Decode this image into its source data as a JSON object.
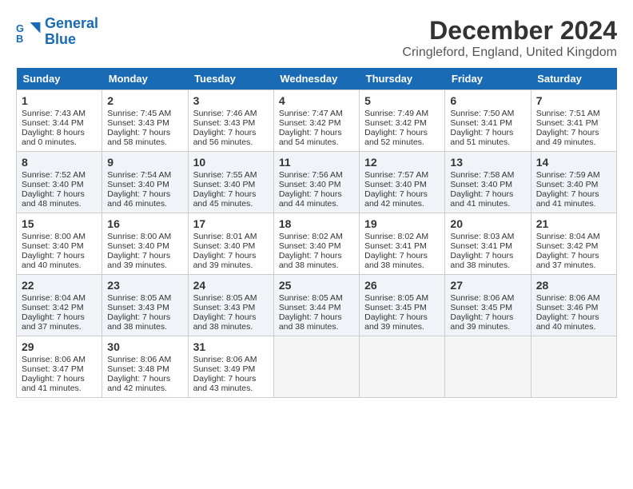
{
  "header": {
    "logo_line1": "General",
    "logo_line2": "Blue",
    "title": "December 2024",
    "subtitle": "Cringleford, England, United Kingdom"
  },
  "days_of_week": [
    "Sunday",
    "Monday",
    "Tuesday",
    "Wednesday",
    "Thursday",
    "Friday",
    "Saturday"
  ],
  "weeks": [
    [
      {
        "day": 1,
        "sunrise": "7:43 AM",
        "sunset": "3:44 PM",
        "daylight": "8 hours and 0 minutes."
      },
      {
        "day": 2,
        "sunrise": "7:45 AM",
        "sunset": "3:43 PM",
        "daylight": "7 hours and 58 minutes."
      },
      {
        "day": 3,
        "sunrise": "7:46 AM",
        "sunset": "3:43 PM",
        "daylight": "7 hours and 56 minutes."
      },
      {
        "day": 4,
        "sunrise": "7:47 AM",
        "sunset": "3:42 PM",
        "daylight": "7 hours and 54 minutes."
      },
      {
        "day": 5,
        "sunrise": "7:49 AM",
        "sunset": "3:42 PM",
        "daylight": "7 hours and 52 minutes."
      },
      {
        "day": 6,
        "sunrise": "7:50 AM",
        "sunset": "3:41 PM",
        "daylight": "7 hours and 51 minutes."
      },
      {
        "day": 7,
        "sunrise": "7:51 AM",
        "sunset": "3:41 PM",
        "daylight": "7 hours and 49 minutes."
      }
    ],
    [
      {
        "day": 8,
        "sunrise": "7:52 AM",
        "sunset": "3:40 PM",
        "daylight": "7 hours and 48 minutes."
      },
      {
        "day": 9,
        "sunrise": "7:54 AM",
        "sunset": "3:40 PM",
        "daylight": "7 hours and 46 minutes."
      },
      {
        "day": 10,
        "sunrise": "7:55 AM",
        "sunset": "3:40 PM",
        "daylight": "7 hours and 45 minutes."
      },
      {
        "day": 11,
        "sunrise": "7:56 AM",
        "sunset": "3:40 PM",
        "daylight": "7 hours and 44 minutes."
      },
      {
        "day": 12,
        "sunrise": "7:57 AM",
        "sunset": "3:40 PM",
        "daylight": "7 hours and 42 minutes."
      },
      {
        "day": 13,
        "sunrise": "7:58 AM",
        "sunset": "3:40 PM",
        "daylight": "7 hours and 41 minutes."
      },
      {
        "day": 14,
        "sunrise": "7:59 AM",
        "sunset": "3:40 PM",
        "daylight": "7 hours and 41 minutes."
      }
    ],
    [
      {
        "day": 15,
        "sunrise": "8:00 AM",
        "sunset": "3:40 PM",
        "daylight": "7 hours and 40 minutes."
      },
      {
        "day": 16,
        "sunrise": "8:00 AM",
        "sunset": "3:40 PM",
        "daylight": "7 hours and 39 minutes."
      },
      {
        "day": 17,
        "sunrise": "8:01 AM",
        "sunset": "3:40 PM",
        "daylight": "7 hours and 39 minutes."
      },
      {
        "day": 18,
        "sunrise": "8:02 AM",
        "sunset": "3:40 PM",
        "daylight": "7 hours and 38 minutes."
      },
      {
        "day": 19,
        "sunrise": "8:02 AM",
        "sunset": "3:41 PM",
        "daylight": "7 hours and 38 minutes."
      },
      {
        "day": 20,
        "sunrise": "8:03 AM",
        "sunset": "3:41 PM",
        "daylight": "7 hours and 38 minutes."
      },
      {
        "day": 21,
        "sunrise": "8:04 AM",
        "sunset": "3:42 PM",
        "daylight": "7 hours and 37 minutes."
      }
    ],
    [
      {
        "day": 22,
        "sunrise": "8:04 AM",
        "sunset": "3:42 PM",
        "daylight": "7 hours and 37 minutes."
      },
      {
        "day": 23,
        "sunrise": "8:05 AM",
        "sunset": "3:43 PM",
        "daylight": "7 hours and 38 minutes."
      },
      {
        "day": 24,
        "sunrise": "8:05 AM",
        "sunset": "3:43 PM",
        "daylight": "7 hours and 38 minutes."
      },
      {
        "day": 25,
        "sunrise": "8:05 AM",
        "sunset": "3:44 PM",
        "daylight": "7 hours and 38 minutes."
      },
      {
        "day": 26,
        "sunrise": "8:05 AM",
        "sunset": "3:45 PM",
        "daylight": "7 hours and 39 minutes."
      },
      {
        "day": 27,
        "sunrise": "8:06 AM",
        "sunset": "3:45 PM",
        "daylight": "7 hours and 39 minutes."
      },
      {
        "day": 28,
        "sunrise": "8:06 AM",
        "sunset": "3:46 PM",
        "daylight": "7 hours and 40 minutes."
      }
    ],
    [
      {
        "day": 29,
        "sunrise": "8:06 AM",
        "sunset": "3:47 PM",
        "daylight": "7 hours and 41 minutes."
      },
      {
        "day": 30,
        "sunrise": "8:06 AM",
        "sunset": "3:48 PM",
        "daylight": "7 hours and 42 minutes."
      },
      {
        "day": 31,
        "sunrise": "8:06 AM",
        "sunset": "3:49 PM",
        "daylight": "7 hours and 43 minutes."
      },
      null,
      null,
      null,
      null
    ]
  ],
  "labels": {
    "sunrise": "Sunrise:",
    "sunset": "Sunset:",
    "daylight": "Daylight:"
  }
}
